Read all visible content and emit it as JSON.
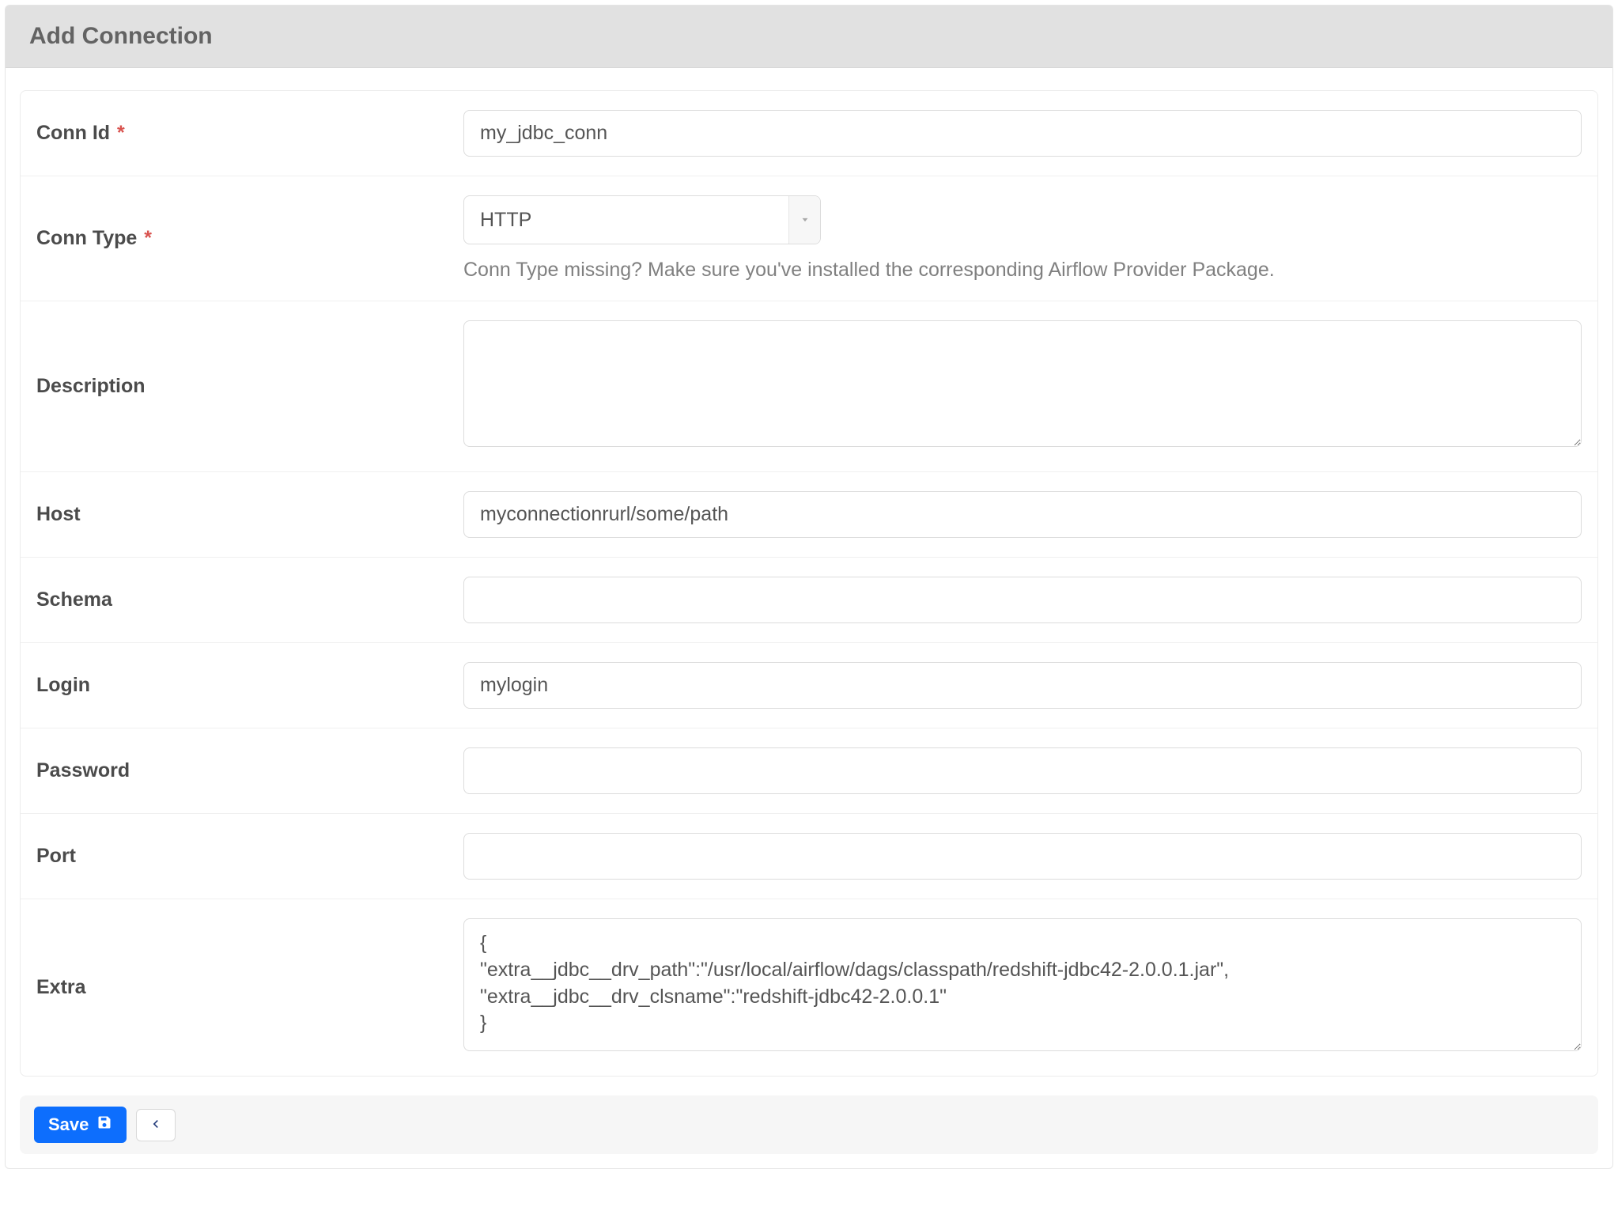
{
  "header": {
    "title": "Add Connection"
  },
  "form": {
    "conn_id": {
      "label": "Conn Id",
      "required": true,
      "value": "my_jdbc_conn"
    },
    "conn_type": {
      "label": "Conn Type",
      "required": true,
      "value": "HTTP",
      "hint": "Conn Type missing? Make sure you've installed the corresponding Airflow Provider Package."
    },
    "description": {
      "label": "Description",
      "value": ""
    },
    "host": {
      "label": "Host",
      "value": "myconnectionrurl/some/path"
    },
    "schema": {
      "label": "Schema",
      "value": ""
    },
    "login": {
      "label": "Login",
      "value": "mylogin"
    },
    "password": {
      "label": "Password",
      "value": ""
    },
    "port": {
      "label": "Port",
      "value": ""
    },
    "extra": {
      "label": "Extra",
      "value": "{\n\"extra__jdbc__drv_path\":\"/usr/local/airflow/dags/classpath/redshift-jdbc42-2.0.0.1.jar\",\n\"extra__jdbc__drv_clsname\":\"redshift-jdbc42-2.0.0.1\"\n}"
    }
  },
  "footer": {
    "save_label": "Save",
    "required_marker": "*"
  }
}
